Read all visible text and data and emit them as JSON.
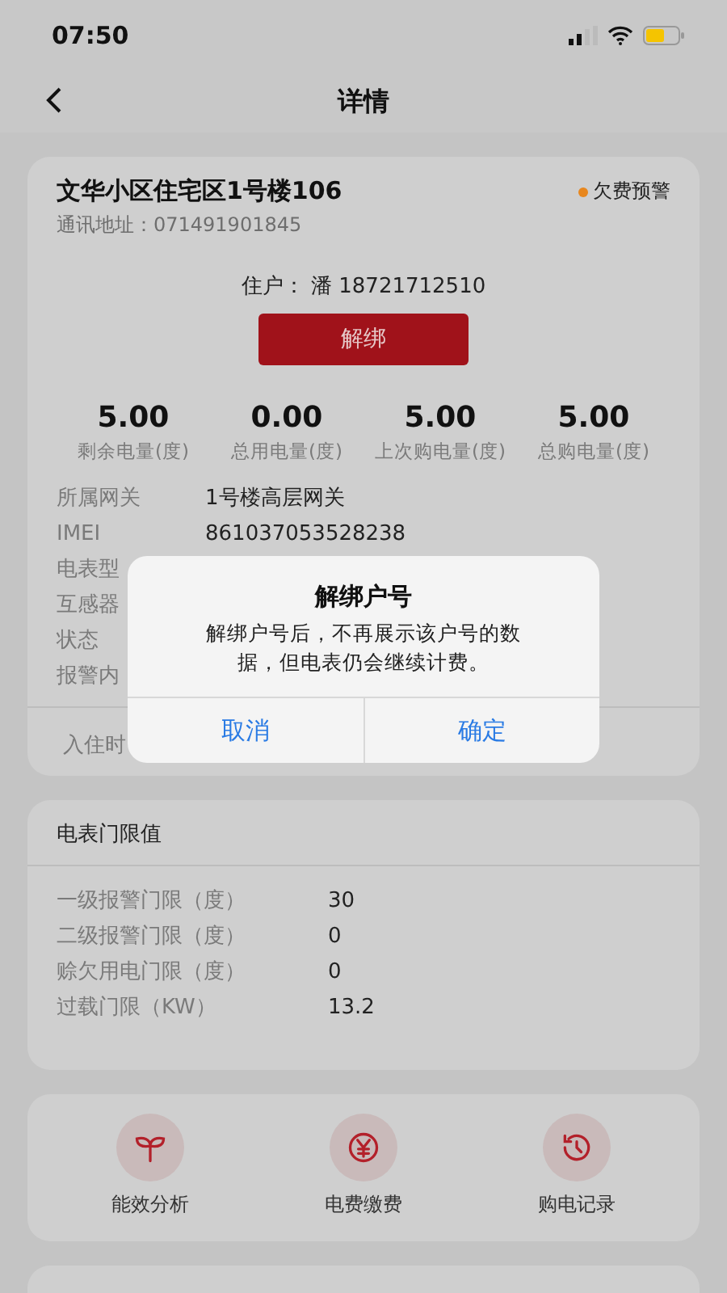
{
  "status_bar": {
    "time": "07:50"
  },
  "header": {
    "title": "详情"
  },
  "meter_card": {
    "title": "文华小区住宅区1号楼106",
    "alert": {
      "label": "欠费预警",
      "color": "#e8871e"
    },
    "address": "通讯地址：071491901845",
    "resident": "住户： 潘 18721712510",
    "unbind_button": "解绑",
    "stats": [
      {
        "value": "5.00",
        "label": "剩余电量(度)"
      },
      {
        "value": "0.00",
        "label": "总用电量(度)"
      },
      {
        "value": "5.00",
        "label": "上次购电量(度)"
      },
      {
        "value": "5.00",
        "label": "总购电量(度)"
      }
    ],
    "details": [
      {
        "label": "所属网关",
        "value": "1号楼高层网关"
      },
      {
        "label": "IMEI",
        "value": "861037053528238"
      },
      {
        "label": "电表型"
      },
      {
        "label": "互感器"
      },
      {
        "label": "状态"
      },
      {
        "label": "报警内"
      }
    ],
    "footer_label": "入住时"
  },
  "threshold_card": {
    "title": "电表门限值",
    "rows": [
      {
        "label": "一级报警门限（度）",
        "value": "30"
      },
      {
        "label": "二级报警门限（度）",
        "value": "0"
      },
      {
        "label": "赊欠用电门限（度）",
        "value": "0"
      },
      {
        "label": "过载门限（KW）",
        "value": "13.2"
      }
    ]
  },
  "actions": [
    {
      "kind": "sprout",
      "label": "能效分析"
    },
    {
      "kind": "payment",
      "label": "电费缴费"
    },
    {
      "kind": "history",
      "label": "购电记录"
    }
  ],
  "dialog": {
    "title": "解绑户号",
    "message": "解绑户号后，不再展示该户号的数据，但电表仍会继续计费。",
    "buttons": [
      "取消",
      "确定"
    ]
  }
}
